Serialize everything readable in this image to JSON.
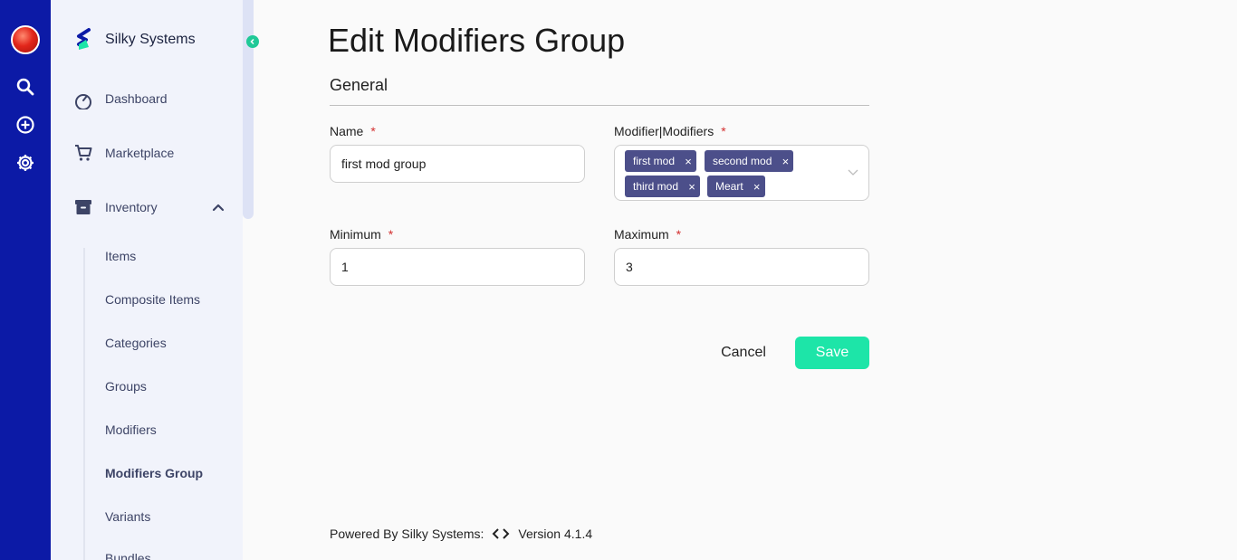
{
  "rail": {
    "icons": [
      "app-avatar",
      "search-icon",
      "add-circle-icon",
      "settings-gear-icon"
    ]
  },
  "sidebar": {
    "brand": "Silky Systems",
    "items": [
      {
        "label": "Dashboard",
        "icon": "speedometer-icon"
      },
      {
        "label": "Marketplace",
        "icon": "cart-icon"
      },
      {
        "label": "Inventory",
        "icon": "archive-box-icon",
        "expanded": true
      }
    ],
    "sub_items": [
      "Items",
      "Composite Items",
      "Categories",
      "Groups",
      "Modifiers",
      "Modifiers Group",
      "Variants",
      "Bundles"
    ],
    "active_sub_item": "Modifiers Group"
  },
  "main": {
    "title": "Edit Modifiers Group",
    "section": "General",
    "form": {
      "name": {
        "label": "Name",
        "required_mark": "*",
        "value": "first mod group"
      },
      "modifiers": {
        "label": "Modifier|Modifiers",
        "required_mark": "*",
        "chips": [
          "first mod",
          "second mod",
          "third mod",
          "Meart"
        ],
        "remove_glyph": "×"
      },
      "minimum": {
        "label": "Minimum",
        "required_mark": "*",
        "value": "1"
      },
      "maximum": {
        "label": "Maximum",
        "required_mark": "*",
        "value": "3"
      }
    },
    "actions": {
      "cancel": "Cancel",
      "save": "Save"
    }
  },
  "footer": {
    "powered_by": "Powered By Silky Systems:",
    "version": "Version 4.1.4"
  },
  "colors": {
    "rail": "#0c1aa6",
    "sidebar": "#f1f3fb",
    "chip": "#4c4f8a",
    "save": "#1de5a8",
    "accent_green": "#20c997",
    "required": "#d32f2f"
  }
}
